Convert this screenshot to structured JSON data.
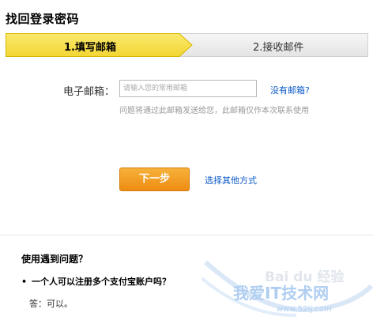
{
  "page": {
    "title": "找回登录密码"
  },
  "steps": [
    {
      "label": "1.填写邮箱",
      "active": true
    },
    {
      "label": "2.接收邮件",
      "active": false
    }
  ],
  "form": {
    "email_label": "电子邮箱：",
    "email_placeholder": "请输入您的常用邮箱",
    "email_value": "",
    "no_email_link": "没有邮箱?",
    "hint": "问题将通过此邮箱发送给您，此邮箱仅作本次联系使用",
    "next_button": "下一步",
    "other_method_link": "选择其他方式"
  },
  "faq": {
    "title": "使用遇到问题？",
    "question_bullet": "•",
    "question": "一个人可以注册多个支付宝账户吗？",
    "answer": "答：可以。"
  },
  "watermark": {
    "text_top": "Bai du 经验",
    "text_main": "我爱IT技术网",
    "text_url": "www.52ij.com"
  },
  "colors": {
    "step_active": "#f7e25a",
    "step_active_border": "#d6b500",
    "step_inactive": "#efefef",
    "link": "#0a59c8",
    "button": "#f0961c"
  }
}
